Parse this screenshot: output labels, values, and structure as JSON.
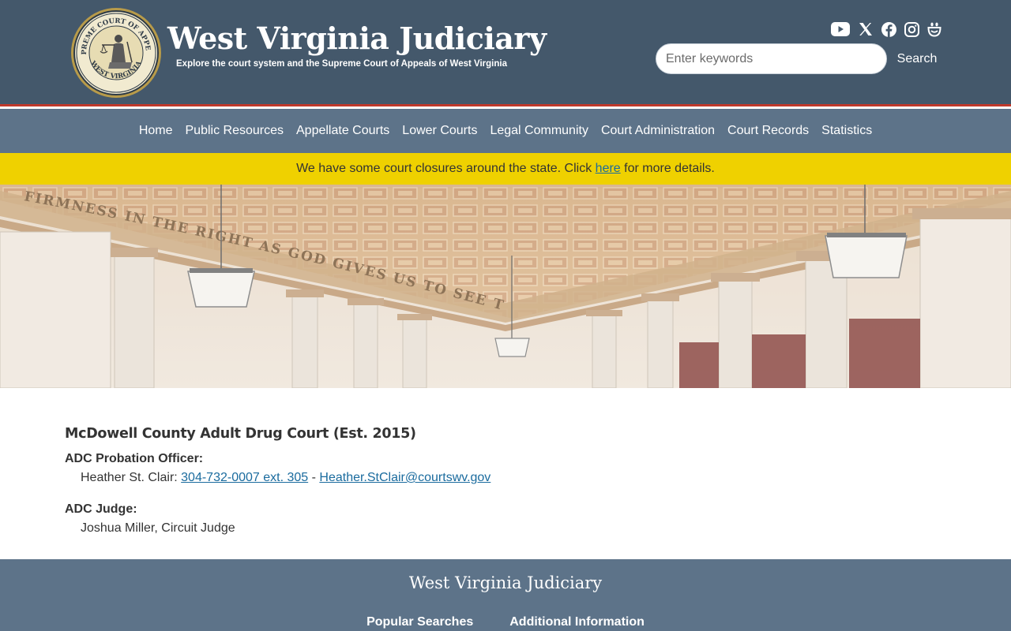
{
  "header": {
    "seal_text_top": "SUPREME COURT OF APPEALS",
    "seal_text_bottom": "WEST VIRGINIA",
    "title": "West Virginia Judiciary",
    "tagline": "Explore the court system and the Supreme Court of Appeals of West Virginia",
    "social": [
      "youtube-icon",
      "x-icon",
      "facebook-icon",
      "instagram-icon",
      "smugmug-icon"
    ],
    "search": {
      "placeholder": "Enter keywords",
      "value": "",
      "button_label": "Search"
    }
  },
  "nav": {
    "items": [
      "Home",
      "Public Resources",
      "Appellate Courts",
      "Lower Courts",
      "Legal Community",
      "Court Administration",
      "Court Records",
      "Statistics"
    ]
  },
  "alert": {
    "before": "We have some court closures around the state. Click ",
    "link": "here",
    "after": " for more details."
  },
  "hero": {
    "inscription": "FIRMNESS IN THE RIGHT AS GOD GIVES US TO SEE THE RIGHT LINCOLN · THE TRUE FOUNDATION OF REPUBLICAN GOVERNMENT"
  },
  "main": {
    "heading": "McDowell County Adult Drug Court (Est. 2015)",
    "probation_label": "ADC Probation Officer:",
    "probation_name": "Heather St. Clair: ",
    "probation_phone": "304-732-0007 ext. 305",
    "probation_sep": " - ",
    "probation_email": "Heather.StClair@courtswv.gov",
    "judge_label": "ADC Judge:",
    "judge_name": "Joshua Miller, Circuit Judge"
  },
  "footer": {
    "title": "West Virginia Judiciary",
    "links": [
      "Popular Searches",
      "Additional Information"
    ]
  },
  "colors": {
    "header_bg": "#44586b",
    "nav_bg": "#5d7389",
    "alert_bg": "#efd100",
    "accent_red": "#c0392b",
    "link": "#1a6b9e"
  }
}
